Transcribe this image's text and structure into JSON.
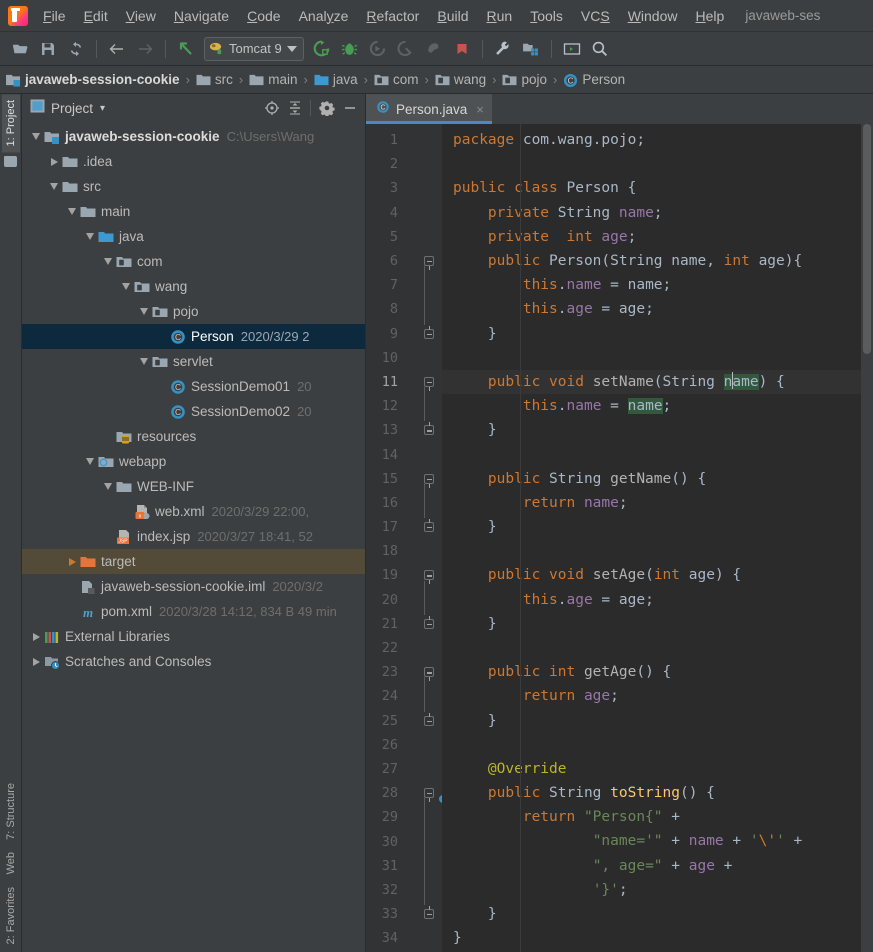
{
  "window": {
    "title": "javaweb-ses"
  },
  "menu": {
    "items": [
      {
        "label": "File",
        "mnemonic": "F"
      },
      {
        "label": "Edit",
        "mnemonic": "E"
      },
      {
        "label": "View",
        "mnemonic": "V"
      },
      {
        "label": "Navigate",
        "mnemonic": "N"
      },
      {
        "label": "Code",
        "mnemonic": "C"
      },
      {
        "label": "Analyze",
        "mnemonic": "y"
      },
      {
        "label": "Refactor",
        "mnemonic": "R"
      },
      {
        "label": "Build",
        "mnemonic": "B"
      },
      {
        "label": "Run",
        "mnemonic": "R"
      },
      {
        "label": "Tools",
        "mnemonic": "T"
      },
      {
        "label": "VCS",
        "mnemonic": "S"
      },
      {
        "label": "Window",
        "mnemonic": "W"
      },
      {
        "label": "Help",
        "mnemonic": "H"
      }
    ]
  },
  "toolbar": {
    "open_label": "open-project-icon",
    "save_label": "save-all-icon",
    "sync_label": "sync-icon",
    "back_label": "back-icon",
    "forward_label": "forward-icon",
    "undo_label": "undo-icon",
    "run_config": "Tomcat 9",
    "run_label": "run-icon",
    "debug_label": "debug-icon",
    "rerun_label": "rerun-icon",
    "coverage_label": "coverage-icon",
    "profile_label": "profile-icon",
    "stop_label": "stop-icon",
    "settings_label": "settings-icon",
    "project-structure_label": "project-structure-icon",
    "terminal_label": "terminal-icon",
    "search_label": "search-everywhere-icon"
  },
  "breadcrumb": {
    "items": [
      {
        "label": "javaweb-session-cookie",
        "icon": "module-icon"
      },
      {
        "label": "src",
        "icon": "folder-icon"
      },
      {
        "label": "main",
        "icon": "folder-icon"
      },
      {
        "label": "java",
        "icon": "source-folder-icon"
      },
      {
        "label": "com",
        "icon": "package-icon"
      },
      {
        "label": "wang",
        "icon": "package-icon"
      },
      {
        "label": "pojo",
        "icon": "package-icon"
      },
      {
        "label": "Person",
        "icon": "class-icon"
      }
    ],
    "separator": "›"
  },
  "left_strip": {
    "tabs": [
      {
        "label": "1: Project",
        "active": true
      },
      {
        "label": "7: Structure",
        "active": false
      },
      {
        "label": "Web",
        "active": false
      },
      {
        "label": "2: Favorites",
        "active": false
      }
    ]
  },
  "project_panel": {
    "title": "Project",
    "dropdown": "▾",
    "tools": [
      "locate-icon",
      "collapse-all-icon",
      "settings-icon",
      "hide-icon"
    ],
    "tree": [
      {
        "indent": 0,
        "twist": "down",
        "icon": "module-icon",
        "label": "javaweb-session-cookie",
        "meta": "C:\\Users\\Wang",
        "bold": true,
        "state": "normal"
      },
      {
        "indent": 1,
        "twist": "right",
        "icon": "folder-icon",
        "label": ".idea",
        "meta": "",
        "state": "normal"
      },
      {
        "indent": 1,
        "twist": "down",
        "icon": "folder-icon",
        "label": "src",
        "meta": "",
        "state": "normal"
      },
      {
        "indent": 2,
        "twist": "down",
        "icon": "folder-icon",
        "label": "main",
        "meta": "",
        "state": "normal"
      },
      {
        "indent": 3,
        "twist": "down",
        "icon": "source-folder-icon",
        "label": "java",
        "meta": "",
        "state": "normal"
      },
      {
        "indent": 4,
        "twist": "down",
        "icon": "package-icon",
        "label": "com",
        "meta": "",
        "state": "normal"
      },
      {
        "indent": 5,
        "twist": "down",
        "icon": "package-icon",
        "label": "wang",
        "meta": "",
        "state": "normal"
      },
      {
        "indent": 6,
        "twist": "down",
        "icon": "package-icon",
        "label": "pojo",
        "meta": "",
        "state": "normal"
      },
      {
        "indent": 7,
        "twist": "none",
        "icon": "class-icon",
        "label": "Person",
        "meta": "2020/3/29 2",
        "state": "selected"
      },
      {
        "indent": 6,
        "twist": "down",
        "icon": "package-icon",
        "label": "servlet",
        "meta": "",
        "state": "normal"
      },
      {
        "indent": 7,
        "twist": "none",
        "icon": "class-icon",
        "label": "SessionDemo01",
        "meta": "20",
        "state": "normal"
      },
      {
        "indent": 7,
        "twist": "none",
        "icon": "class-icon",
        "label": "SessionDemo02",
        "meta": "20",
        "state": "normal"
      },
      {
        "indent": 4,
        "twist": "none",
        "icon": "resources-folder-icon",
        "label": "resources",
        "meta": "",
        "state": "normal"
      },
      {
        "indent": 3,
        "twist": "down",
        "icon": "webapp-folder-icon",
        "label": "webapp",
        "meta": "",
        "state": "normal"
      },
      {
        "indent": 4,
        "twist": "down",
        "icon": "folder-icon",
        "label": "WEB-INF",
        "meta": "",
        "state": "normal"
      },
      {
        "indent": 5,
        "twist": "none",
        "icon": "xml-file-icon",
        "label": "web.xml",
        "meta": "2020/3/29 22:00,",
        "state": "normal"
      },
      {
        "indent": 4,
        "twist": "none",
        "icon": "jsp-file-icon",
        "label": "index.jsp",
        "meta": "2020/3/27 18:41, 52",
        "state": "normal"
      },
      {
        "indent": 2,
        "twist": "right-orange",
        "icon": "target-folder-icon",
        "label": "target",
        "meta": "",
        "state": "highlight"
      },
      {
        "indent": 2,
        "twist": "none",
        "icon": "iml-file-icon",
        "label": "javaweb-session-cookie.iml",
        "meta": "2020/3/2",
        "state": "normal"
      },
      {
        "indent": 2,
        "twist": "none",
        "icon": "maven-file-icon",
        "label": "pom.xml",
        "meta": "2020/3/28 14:12, 834 B 49 min",
        "state": "normal"
      },
      {
        "indent": 0,
        "twist": "right",
        "icon": "libraries-icon",
        "label": "External Libraries",
        "meta": "",
        "state": "normal"
      },
      {
        "indent": 0,
        "twist": "right",
        "icon": "scratches-icon",
        "label": "Scratches and Consoles",
        "meta": "",
        "state": "normal"
      }
    ]
  },
  "editor": {
    "tabs": [
      {
        "label": "Person.java",
        "icon": "class-icon",
        "active": true,
        "close": "×"
      }
    ],
    "current_line": 11,
    "lines": [
      {
        "n": 1,
        "fold": "",
        "tokens": [
          {
            "t": "package",
            "c": "kw"
          },
          {
            "t": " com.wang.pojo;",
            "c": "pun"
          }
        ]
      },
      {
        "n": 2,
        "fold": "",
        "tokens": []
      },
      {
        "n": 3,
        "fold": "",
        "tokens": [
          {
            "t": "public ",
            "c": "kw"
          },
          {
            "t": "class ",
            "c": "kw"
          },
          {
            "t": "Person ",
            "c": "cls"
          },
          {
            "t": "{",
            "c": "pun"
          }
        ]
      },
      {
        "n": 4,
        "fold": "",
        "tokens": [
          {
            "t": "    ",
            "c": "pun"
          },
          {
            "t": "private ",
            "c": "kw"
          },
          {
            "t": "String ",
            "c": "cls"
          },
          {
            "t": "name",
            "c": "fld"
          },
          {
            "t": ";",
            "c": "pun"
          }
        ]
      },
      {
        "n": 5,
        "fold": "",
        "tokens": [
          {
            "t": "    ",
            "c": "pun"
          },
          {
            "t": "private  ",
            "c": "kw"
          },
          {
            "t": "int ",
            "c": "kw"
          },
          {
            "t": "age",
            "c": "fld"
          },
          {
            "t": ";",
            "c": "pun"
          }
        ]
      },
      {
        "n": 6,
        "fold": "open",
        "tokens": [
          {
            "t": "    ",
            "c": "pun"
          },
          {
            "t": "public ",
            "c": "kw"
          },
          {
            "t": "Person",
            "c": "cls"
          },
          {
            "t": "(",
            "c": "pun"
          },
          {
            "t": "String ",
            "c": "cls"
          },
          {
            "t": "name",
            "c": "pun"
          },
          {
            "t": ", ",
            "c": "pun"
          },
          {
            "t": "int ",
            "c": "kw"
          },
          {
            "t": "age",
            "c": "pun"
          },
          {
            "t": "){",
            "c": "pun"
          }
        ]
      },
      {
        "n": 7,
        "fold": "",
        "tokens": [
          {
            "t": "        ",
            "c": "pun"
          },
          {
            "t": "this",
            "c": "kw"
          },
          {
            "t": ".",
            "c": "pun"
          },
          {
            "t": "name",
            "c": "fld"
          },
          {
            "t": " = name;",
            "c": "pun"
          }
        ]
      },
      {
        "n": 8,
        "fold": "",
        "tokens": [
          {
            "t": "        ",
            "c": "pun"
          },
          {
            "t": "this",
            "c": "kw"
          },
          {
            "t": ".",
            "c": "pun"
          },
          {
            "t": "age",
            "c": "fld"
          },
          {
            "t": " = age;",
            "c": "pun"
          }
        ]
      },
      {
        "n": 9,
        "fold": "close",
        "tokens": [
          {
            "t": "    }",
            "c": "pun"
          }
        ]
      },
      {
        "n": 10,
        "fold": "",
        "tokens": []
      },
      {
        "n": 11,
        "fold": "open",
        "tokens": [
          {
            "t": "    ",
            "c": "pun"
          },
          {
            "t": "public ",
            "c": "kw"
          },
          {
            "t": "void ",
            "c": "kw"
          },
          {
            "t": "setName",
            "c": "mthd"
          },
          {
            "t": "(",
            "c": "pun"
          },
          {
            "t": "String ",
            "c": "cls"
          },
          {
            "t": "name",
            "c": "sel"
          },
          {
            "t": ") {",
            "c": "pun"
          }
        ]
      },
      {
        "n": 12,
        "fold": "",
        "tokens": [
          {
            "t": "        ",
            "c": "pun"
          },
          {
            "t": "this",
            "c": "kw"
          },
          {
            "t": ".",
            "c": "pun"
          },
          {
            "t": "name",
            "c": "fld"
          },
          {
            "t": " = ",
            "c": "pun"
          },
          {
            "t": "name",
            "c": "sel"
          },
          {
            "t": ";",
            "c": "pun"
          }
        ]
      },
      {
        "n": 13,
        "fold": "close",
        "tokens": [
          {
            "t": "    }",
            "c": "pun"
          }
        ]
      },
      {
        "n": 14,
        "fold": "",
        "tokens": []
      },
      {
        "n": 15,
        "fold": "open",
        "tokens": [
          {
            "t": "    ",
            "c": "pun"
          },
          {
            "t": "public ",
            "c": "kw"
          },
          {
            "t": "String ",
            "c": "cls"
          },
          {
            "t": "getName",
            "c": "mthd"
          },
          {
            "t": "() {",
            "c": "pun"
          }
        ]
      },
      {
        "n": 16,
        "fold": "",
        "tokens": [
          {
            "t": "        ",
            "c": "pun"
          },
          {
            "t": "return ",
            "c": "kw"
          },
          {
            "t": "name",
            "c": "fld"
          },
          {
            "t": ";",
            "c": "pun"
          }
        ]
      },
      {
        "n": 17,
        "fold": "close",
        "tokens": [
          {
            "t": "    }",
            "c": "pun"
          }
        ]
      },
      {
        "n": 18,
        "fold": "",
        "tokens": []
      },
      {
        "n": 19,
        "fold": "open",
        "tokens": [
          {
            "t": "    ",
            "c": "pun"
          },
          {
            "t": "public ",
            "c": "kw"
          },
          {
            "t": "void ",
            "c": "kw"
          },
          {
            "t": "setAge",
            "c": "mthd"
          },
          {
            "t": "(",
            "c": "pun"
          },
          {
            "t": "int ",
            "c": "kw"
          },
          {
            "t": "age",
            "c": "pun"
          },
          {
            "t": ") {",
            "c": "pun"
          }
        ]
      },
      {
        "n": 20,
        "fold": "",
        "tokens": [
          {
            "t": "        ",
            "c": "pun"
          },
          {
            "t": "this",
            "c": "kw"
          },
          {
            "t": ".",
            "c": "pun"
          },
          {
            "t": "age",
            "c": "fld"
          },
          {
            "t": " = age;",
            "c": "pun"
          }
        ]
      },
      {
        "n": 21,
        "fold": "close",
        "tokens": [
          {
            "t": "    }",
            "c": "pun"
          }
        ]
      },
      {
        "n": 22,
        "fold": "",
        "tokens": []
      },
      {
        "n": 23,
        "fold": "open",
        "tokens": [
          {
            "t": "    ",
            "c": "pun"
          },
          {
            "t": "public ",
            "c": "kw"
          },
          {
            "t": "int ",
            "c": "kw"
          },
          {
            "t": "getAge",
            "c": "mthd"
          },
          {
            "t": "() {",
            "c": "pun"
          }
        ]
      },
      {
        "n": 24,
        "fold": "",
        "tokens": [
          {
            "t": "        ",
            "c": "pun"
          },
          {
            "t": "return ",
            "c": "kw"
          },
          {
            "t": "age",
            "c": "fld"
          },
          {
            "t": ";",
            "c": "pun"
          }
        ]
      },
      {
        "n": 25,
        "fold": "close",
        "tokens": [
          {
            "t": "    }",
            "c": "pun"
          }
        ]
      },
      {
        "n": 26,
        "fold": "",
        "tokens": []
      },
      {
        "n": 27,
        "fold": "",
        "tokens": [
          {
            "t": "    ",
            "c": "pun"
          },
          {
            "t": "@Override",
            "c": "ann"
          }
        ]
      },
      {
        "n": 28,
        "fold": "open",
        "gutter_icon": "override-method-icon",
        "tokens": [
          {
            "t": "    ",
            "c": "pun"
          },
          {
            "t": "public ",
            "c": "kw"
          },
          {
            "t": "String ",
            "c": "cls"
          },
          {
            "t": "toString",
            "c": "mth"
          },
          {
            "t": "() {",
            "c": "pun"
          }
        ]
      },
      {
        "n": 29,
        "fold": "",
        "tokens": [
          {
            "t": "        ",
            "c": "pun"
          },
          {
            "t": "return ",
            "c": "kw"
          },
          {
            "t": "\"Person{\"",
            "c": "str"
          },
          {
            "t": " +",
            "c": "pun"
          }
        ]
      },
      {
        "n": 30,
        "fold": "",
        "tokens": [
          {
            "t": "                ",
            "c": "pun"
          },
          {
            "t": "\"name='\"",
            "c": "str"
          },
          {
            "t": " + ",
            "c": "pun"
          },
          {
            "t": "name",
            "c": "fld"
          },
          {
            "t": " + ",
            "c": "pun"
          },
          {
            "t": "'",
            "c": "str"
          },
          {
            "t": "\\'",
            "c": "esc"
          },
          {
            "t": "'",
            "c": "str"
          },
          {
            "t": " +",
            "c": "pun"
          }
        ]
      },
      {
        "n": 31,
        "fold": "",
        "tokens": [
          {
            "t": "                ",
            "c": "pun"
          },
          {
            "t": "\", age=\"",
            "c": "str"
          },
          {
            "t": " + ",
            "c": "pun"
          },
          {
            "t": "age",
            "c": "fld"
          },
          {
            "t": " +",
            "c": "pun"
          }
        ]
      },
      {
        "n": 32,
        "fold": "",
        "tokens": [
          {
            "t": "                ",
            "c": "pun"
          },
          {
            "t": "'}'",
            "c": "str"
          },
          {
            "t": ";",
            "c": "pun"
          }
        ]
      },
      {
        "n": 33,
        "fold": "close",
        "tokens": [
          {
            "t": "    }",
            "c": "pun"
          }
        ]
      },
      {
        "n": 34,
        "fold": "",
        "tokens": [
          {
            "t": "}",
            "c": "pun"
          }
        ]
      }
    ]
  },
  "colors": {
    "accent": "#4a88c7",
    "keyword": "#cc7832",
    "string": "#6a8759",
    "field": "#9876aa",
    "method": "#ffc66d",
    "annotation": "#bbb529",
    "selection": "#32593d",
    "tree_selected": "#0d293e",
    "tree_highlight": "#534b38",
    "editor_bg": "#2b2b2b",
    "panel_bg": "#3c3f41"
  }
}
